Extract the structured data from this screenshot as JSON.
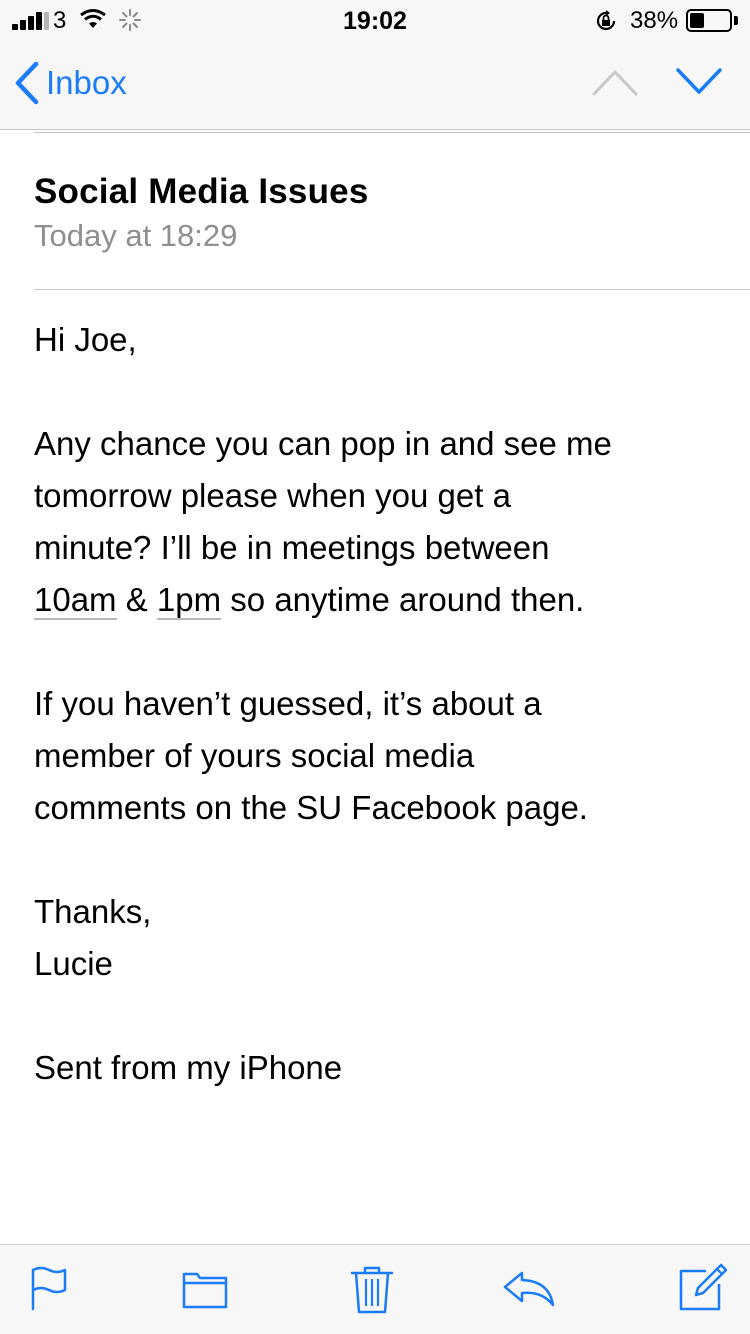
{
  "status": {
    "carrier": "3",
    "time": "19:02",
    "battery_percent": "38%",
    "battery_level": 0.38
  },
  "nav": {
    "back_label": "Inbox",
    "accent_color": "#1a7cf6"
  },
  "email": {
    "subject": "Social Media Issues",
    "date": "Today at 18:29",
    "greeting": "Hi Joe,",
    "p1_line1": "Any chance you can pop in and see me",
    "p1_line2": "tomorrow please when you get a",
    "p1_line3": "minute? I’ll be in meetings between",
    "p1_link1": "10am",
    "p1_amp": " & ",
    "p1_link2": "1pm",
    "p1_tail": " so anytime around then.",
    "p2_line1": "If you haven’t guessed, it’s about a",
    "p2_line2": "member of yours social media",
    "p2_line3": "comments on the SU Facebook page.",
    "signoff": "Thanks,",
    "sender": "Lucie",
    "signature": "Sent from my iPhone"
  },
  "toolbar": {
    "icons": [
      "flag-icon",
      "folder-icon",
      "trash-icon",
      "reply-icon",
      "compose-icon"
    ]
  }
}
